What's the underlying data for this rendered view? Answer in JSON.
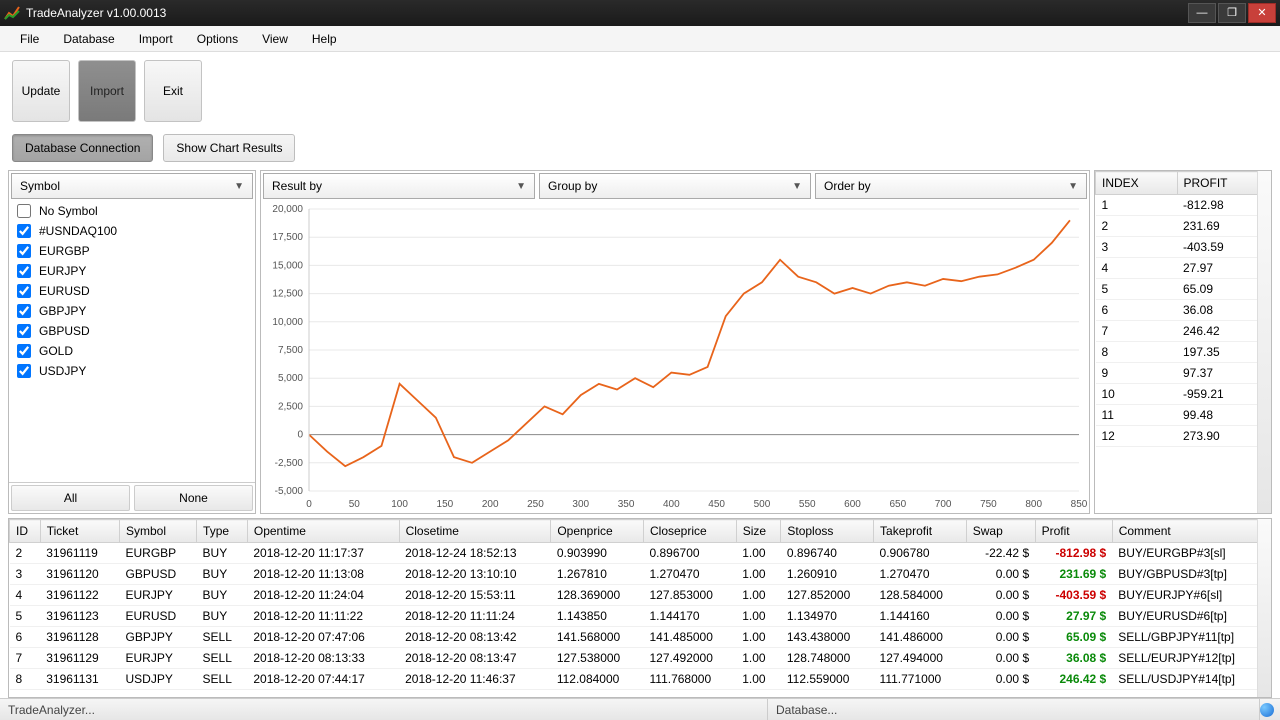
{
  "titlebar": {
    "title": "TradeAnalyzer v1.00.0013"
  },
  "menubar": [
    "File",
    "Database",
    "Import",
    "Options",
    "View",
    "Help"
  ],
  "toolbar_big": {
    "update": "Update",
    "import": "Import",
    "exit": "Exit"
  },
  "toolbar_pill": {
    "db": "Database Connection",
    "chart": "Show Chart Results"
  },
  "symbol_dropdown": "Symbol",
  "symbols": [
    {
      "label": "No Symbol",
      "checked": false
    },
    {
      "label": "#USNDAQ100",
      "checked": true
    },
    {
      "label": "EURGBP",
      "checked": true
    },
    {
      "label": "EURJPY",
      "checked": true
    },
    {
      "label": "EURUSD",
      "checked": true
    },
    {
      "label": "GBPJPY",
      "checked": true
    },
    {
      "label": "GBPUSD",
      "checked": true
    },
    {
      "label": "GOLD",
      "checked": true
    },
    {
      "label": "USDJPY",
      "checked": true
    }
  ],
  "symbol_btns": {
    "all": "All",
    "none": "None"
  },
  "chart_dropdowns": {
    "result": "Result by",
    "group": "Group by",
    "order": "Order by"
  },
  "profit_headers": {
    "index": "INDEX",
    "profit": "PROFIT"
  },
  "profit_rows": [
    {
      "index": "1",
      "profit": "-812.98"
    },
    {
      "index": "2",
      "profit": "231.69"
    },
    {
      "index": "3",
      "profit": "-403.59"
    },
    {
      "index": "4",
      "profit": "27.97"
    },
    {
      "index": "5",
      "profit": "65.09"
    },
    {
      "index": "6",
      "profit": "36.08"
    },
    {
      "index": "7",
      "profit": "246.42"
    },
    {
      "index": "8",
      "profit": "197.35"
    },
    {
      "index": "9",
      "profit": "97.37"
    },
    {
      "index": "10",
      "profit": "-959.21"
    },
    {
      "index": "11",
      "profit": "99.48"
    },
    {
      "index": "12",
      "profit": "273.90"
    }
  ],
  "table_headers": [
    "ID",
    "Ticket",
    "Symbol",
    "Type",
    "Opentime",
    "Closetime",
    "Openprice",
    "Closeprice",
    "Size",
    "Stoploss",
    "Takeprofit",
    "Swap",
    "Profit",
    "Comment"
  ],
  "table_rows": [
    {
      "id": "2",
      "ticket": "31961119",
      "symbol": "EURGBP",
      "type": "BUY",
      "open": "2018-12-20 11:17:37",
      "close": "2018-12-24 18:52:13",
      "op": "0.903990",
      "cp": "0.896700",
      "size": "1.00",
      "sl": "0.896740",
      "tp": "0.906780",
      "swap": "-22.42 $",
      "profit": "-812.98 $",
      "comment": "BUY/EURGBP#3[sl]"
    },
    {
      "id": "3",
      "ticket": "31961120",
      "symbol": "GBPUSD",
      "type": "BUY",
      "open": "2018-12-20 11:13:08",
      "close": "2018-12-20 13:10:10",
      "op": "1.267810",
      "cp": "1.270470",
      "size": "1.00",
      "sl": "1.260910",
      "tp": "1.270470",
      "swap": "0.00 $",
      "profit": "231.69 $",
      "comment": "BUY/GBPUSD#3[tp]"
    },
    {
      "id": "4",
      "ticket": "31961122",
      "symbol": "EURJPY",
      "type": "BUY",
      "open": "2018-12-20 11:24:04",
      "close": "2018-12-20 15:53:11",
      "op": "128.369000",
      "cp": "127.853000",
      "size": "1.00",
      "sl": "127.852000",
      "tp": "128.584000",
      "swap": "0.00 $",
      "profit": "-403.59 $",
      "comment": "BUY/EURJPY#6[sl]"
    },
    {
      "id": "5",
      "ticket": "31961123",
      "symbol": "EURUSD",
      "type": "BUY",
      "open": "2018-12-20 11:11:22",
      "close": "2018-12-20 11:11:24",
      "op": "1.143850",
      "cp": "1.144170",
      "size": "1.00",
      "sl": "1.134970",
      "tp": "1.144160",
      "swap": "0.00 $",
      "profit": "27.97 $",
      "comment": "BUY/EURUSD#6[tp]"
    },
    {
      "id": "6",
      "ticket": "31961128",
      "symbol": "GBPJPY",
      "type": "SELL",
      "open": "2018-12-20 07:47:06",
      "close": "2018-12-20 08:13:42",
      "op": "141.568000",
      "cp": "141.485000",
      "size": "1.00",
      "sl": "143.438000",
      "tp": "141.486000",
      "swap": "0.00 $",
      "profit": "65.09 $",
      "comment": "SELL/GBPJPY#11[tp]"
    },
    {
      "id": "7",
      "ticket": "31961129",
      "symbol": "EURJPY",
      "type": "SELL",
      "open": "2018-12-20 08:13:33",
      "close": "2018-12-20 08:13:47",
      "op": "127.538000",
      "cp": "127.492000",
      "size": "1.00",
      "sl": "128.748000",
      "tp": "127.494000",
      "swap": "0.00 $",
      "profit": "36.08 $",
      "comment": "SELL/EURJPY#12[tp]"
    },
    {
      "id": "8",
      "ticket": "31961131",
      "symbol": "USDJPY",
      "type": "SELL",
      "open": "2018-12-20 07:44:17",
      "close": "2018-12-20 11:46:37",
      "op": "112.084000",
      "cp": "111.768000",
      "size": "1.00",
      "sl": "112.559000",
      "tp": "111.771000",
      "swap": "0.00 $",
      "profit": "246.42 $",
      "comment": "SELL/USDJPY#14[tp]"
    }
  ],
  "statusbar": {
    "left": "TradeAnalyzer...",
    "right": "Database..."
  },
  "chart_data": {
    "type": "line",
    "xlabel": "",
    "ylabel": "",
    "xlim": [
      0,
      850
    ],
    "ylim": [
      -5000,
      20000
    ],
    "xticks": [
      0,
      50,
      100,
      150,
      200,
      250,
      300,
      350,
      400,
      450,
      500,
      550,
      600,
      650,
      700,
      750,
      800,
      850
    ],
    "yticks": [
      -5000,
      -2500,
      0,
      2500,
      5000,
      7500,
      10000,
      12500,
      15000,
      17500,
      20000
    ],
    "x": [
      0,
      20,
      40,
      60,
      80,
      100,
      120,
      140,
      160,
      180,
      200,
      220,
      240,
      260,
      280,
      300,
      320,
      340,
      360,
      380,
      400,
      420,
      440,
      460,
      480,
      500,
      520,
      540,
      560,
      580,
      600,
      620,
      640,
      660,
      680,
      700,
      720,
      740,
      760,
      780,
      800,
      820,
      840
    ],
    "y": [
      0,
      -1500,
      -2800,
      -2000,
      -1000,
      4500,
      3000,
      1500,
      -2000,
      -2500,
      -1500,
      -500,
      1000,
      2500,
      1800,
      3500,
      4500,
      4000,
      5000,
      4200,
      5500,
      5300,
      6000,
      10500,
      12500,
      13500,
      15500,
      14000,
      13500,
      12500,
      13000,
      12500,
      13200,
      13500,
      13200,
      13800,
      13600,
      14000,
      14200,
      14800,
      15500,
      17000,
      19000
    ]
  }
}
